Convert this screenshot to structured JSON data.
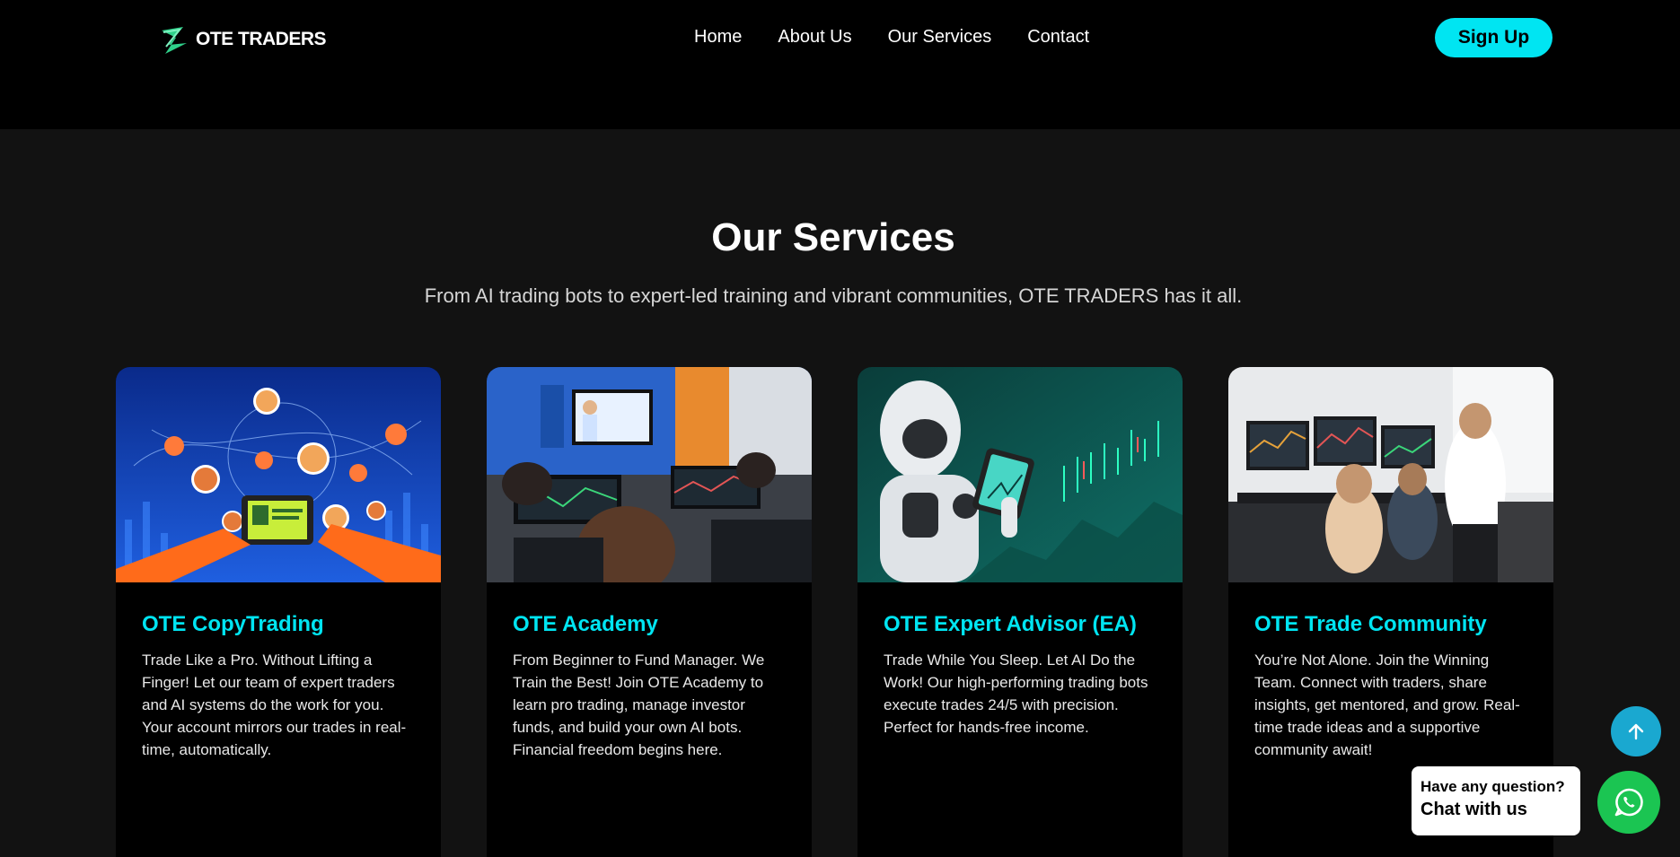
{
  "header": {
    "logo_text": "OTE TRADERS",
    "nav": [
      {
        "label": "Home"
      },
      {
        "label": "About Us"
      },
      {
        "label": "Our Services"
      },
      {
        "label": "Contact"
      }
    ],
    "signup_label": "Sign Up"
  },
  "services": {
    "title": "Our Services",
    "subtitle": "From AI trading bots to expert-led training and vibrant communities, OTE TRADERS has it all.",
    "cards": [
      {
        "title": "OTE CopyTrading",
        "text": "Trade Like a Pro. Without Lifting a Finger! Let our team of expert traders and AI systems do the work for you. Your account mirrors our trades in real-time, automatically.",
        "image": "social-network-tablet-illustration"
      },
      {
        "title": "OTE Academy",
        "text": "From Beginner to Fund Manager. We Train the Best! Join OTE Academy to learn pro trading, manage investor funds, and build your own AI bots. Financial freedom begins here.",
        "image": "trading-classroom-photo"
      },
      {
        "title": "OTE Expert Advisor (EA)",
        "text": "Trade While You Sleep. Let AI Do the Work! Our high-performing trading bots execute trades 24/5 with precision. Perfect for hands-free income.",
        "image": "robot-with-tablet-chart-photo"
      },
      {
        "title": "OTE Trade Community",
        "text": "You’re Not Alone. Join the Winning Team. Connect with traders, share insights, get mentored, and grow. Real-time trade ideas and a supportive community await!",
        "image": "traders-office-photo"
      }
    ]
  },
  "widgets": {
    "chat_question": "Have any question?",
    "chat_cta": "Chat with us",
    "scroll_top_icon": "arrow-up-icon",
    "whatsapp_icon": "whatsapp-icon"
  },
  "colors": {
    "accent": "#00e5f2",
    "page_bg": "#121212",
    "header_bg": "#000000",
    "card_bg": "#000000",
    "logo_green": "#2fd08a",
    "scroll_top_bg": "#1aa8d0",
    "whatsapp_bg": "#1bc552"
  }
}
